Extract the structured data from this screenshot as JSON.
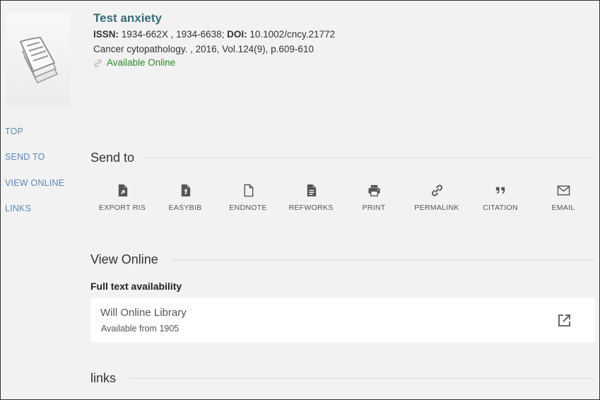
{
  "record": {
    "title": "Test anxiety",
    "issn_label": "ISSN:",
    "issn_value": " 1934-662X , 1934-6638; ",
    "doi_label": "DOI:",
    "doi_value": " 10.1002/cncy.21772",
    "source": "Cancer cytopathology. , 2016, Vol.124(9), p.609-610",
    "availability": "Available Online"
  },
  "sidenav": {
    "items": [
      "TOP",
      "SEND TO",
      "VIEW ONLINE",
      "LINKS"
    ]
  },
  "send_to": {
    "heading": "Send to",
    "actions": [
      {
        "label": "EXPORT RIS",
        "icon": "export-ris-icon"
      },
      {
        "label": "EASYBIB",
        "icon": "easybib-icon"
      },
      {
        "label": "ENDNOTE",
        "icon": "endnote-icon"
      },
      {
        "label": "REFWORKS",
        "icon": "refworks-icon"
      },
      {
        "label": "PRINT",
        "icon": "print-icon"
      },
      {
        "label": "PERMALINK",
        "icon": "permalink-icon"
      },
      {
        "label": "CITATION",
        "icon": "citation-icon"
      },
      {
        "label": "EMAIL",
        "icon": "email-icon"
      }
    ]
  },
  "view_online": {
    "heading": "View Online",
    "subheading": "Full text availability",
    "provider_name": "Will Online Library",
    "provider_coverage": "Available from 1905"
  },
  "links": {
    "heading": "links"
  },
  "colors": {
    "title": "#3b6a77",
    "available": "#2b8a2b",
    "nav_link": "#5b87b5",
    "background": "#f2f2f2"
  }
}
